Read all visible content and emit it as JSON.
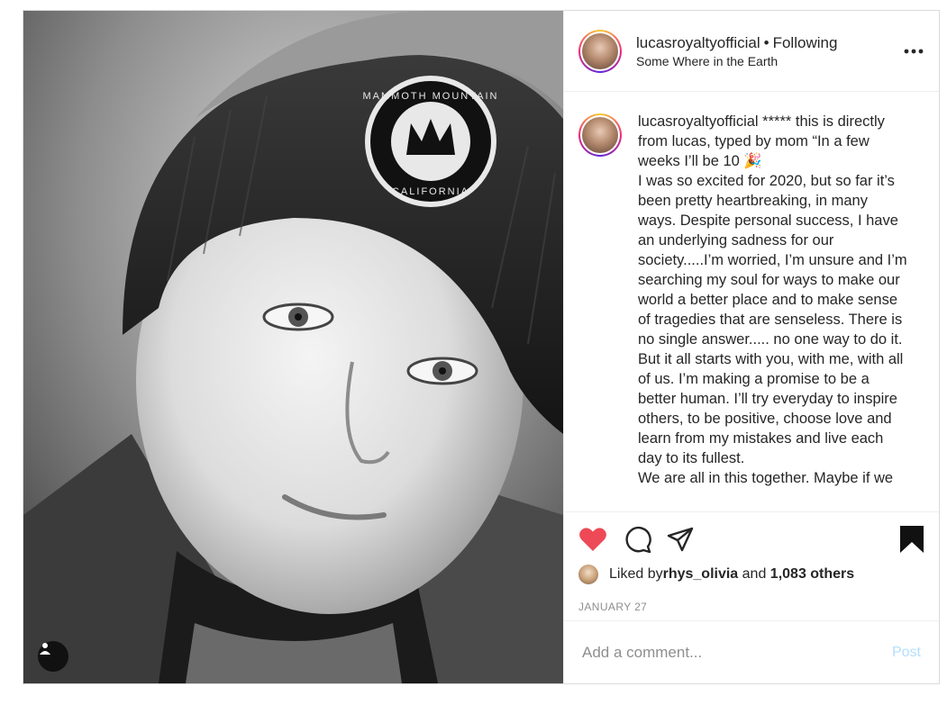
{
  "post": {
    "image_alt": "Black and white portrait of a boy wearing a knit beanie",
    "beanie_patch": {
      "top_text": "MAMMOTH MOUNTAIN",
      "bottom_text": "CALIFORNIA"
    }
  },
  "header": {
    "username": "lucasroyaltyofficial",
    "separator": "•",
    "follow_status": "Following",
    "location": "Some Where in the Earth",
    "more_icon": "more-horizontal-icon"
  },
  "caption": {
    "username": "lucasroyaltyofficial",
    "text": " ***** this is directly from lucas, typed by mom “In a few weeks I’ll be 10 🎉\nI was so excited for 2020, but so far it’s been pretty heartbreaking, in many ways. Despite personal success, I have an underlying sadness for our society.....I’m worried, I’m unsure and I’m searching my soul for ways to make our world a better place and to make sense of tragedies that are senseless. There is no single answer..... no one way to do it. But it all starts with you, with me, with all of us. I’m making a promise to be a better human. I’ll try everyday to inspire others, to be positive, choose love and learn from my mistakes and live each day to its fullest.\nWe are all in this together. Maybe if we"
  },
  "actions": {
    "like_icon": "heart-filled-icon",
    "comment_icon": "comment-icon",
    "share_icon": "paper-plane-icon",
    "save_icon": "bookmark-filled-icon",
    "like_color": "#ed4956"
  },
  "likes": {
    "prefix": "Liked by ",
    "first_liker": "rhys_olivia",
    "conjunction": " and ",
    "others": "1,083 others"
  },
  "date": "JANUARY 27",
  "comment": {
    "placeholder": "Add a comment...",
    "post_label": "Post",
    "post_color": "#b2dffc"
  }
}
